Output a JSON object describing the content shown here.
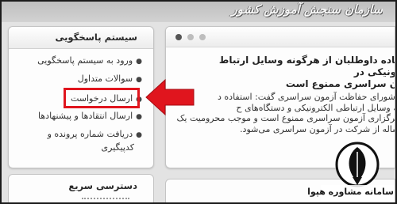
{
  "header": {
    "site_title": "سازمان سنجش آموزش کشور"
  },
  "sidebar": {
    "title": "سیستم پاسخگویی",
    "items": [
      {
        "label": "ورود به سیستم پاسخگویی"
      },
      {
        "label": "سوالات متداول"
      },
      {
        "label": "ارسال درخواست"
      },
      {
        "label": "ارسال انتقادها و پیشنهادها"
      },
      {
        "label_line1": "دریافت شماره پرونده و",
        "label_line2": "کدپیگیری"
      }
    ],
    "quick_access_title": "دسترسی سریع"
  },
  "news": {
    "title_line1": "استفاده داوطلبان از هرگونه وسایل ارتباط الکترونیکی در",
    "title_line2": "آزمون سراسری ممنوع است",
    "body_lines": [
      "رئیس شورای حفاظت آزمون سراسری گفت: استفاده د",
      "هرگونه وسایل ارتباطی الکترونیکی و دستگاه‌های ح",
      "زمان برگزاری آزمون سراسری ممنوع است و موجب محرومیت یک",
      "تا دو ساله از شرکت در آزمون سراسری می‌شود."
    ],
    "slider_dots": 3,
    "active_dot": 0
  },
  "highlight": {
    "color": "#e0151e",
    "target": "ارسال درخواست"
  },
  "watermark": {
    "text": "سامانه مشاوره هپوا",
    "icon": "feather-pen-icon"
  }
}
